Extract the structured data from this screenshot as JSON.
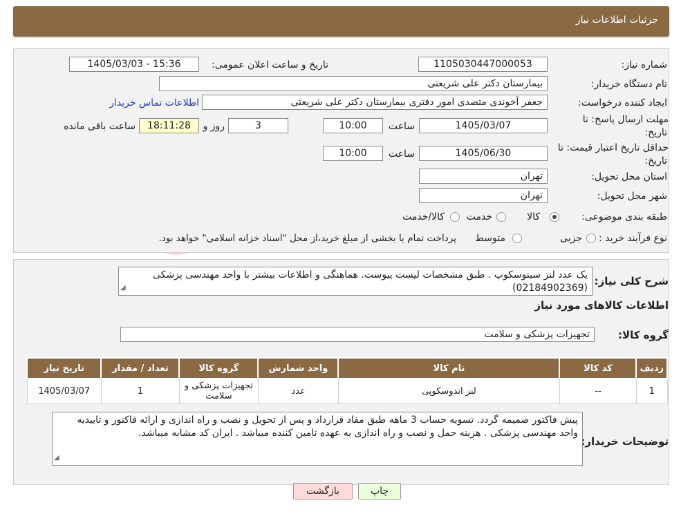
{
  "header": {
    "title": "جزئیات اطلاعات نیاز"
  },
  "form": {
    "need_number": {
      "label": "شماره نیاز:",
      "value": "1105030447000053"
    },
    "announce": {
      "label": "تاریخ و ساعت اعلان عمومی:",
      "value": "1405/03/03 - 15:36"
    },
    "buyer_org": {
      "label": "نام دستگاه خریدار:",
      "value": "بیمارستان دکتر علی شریعتی"
    },
    "creator": {
      "label": "ایجاد کننده درخواست:",
      "value": "جعفر آخوندی متصدی امور دفتری بیمارستان دکتر علی شریعتی",
      "contact_link": "اطلاعات تماس خریدار"
    },
    "reply_deadline": {
      "label_line1": "مهلت ارسال پاسخ: تا",
      "label_line2": "تاریخ:",
      "date": "1405/03/07",
      "time_label": "ساعت",
      "time": "10:00",
      "days": "3",
      "days_label": "روز و",
      "remaining_time": "18:11:28",
      "remaining_label": "ساعت باقی مانده"
    },
    "price_validity": {
      "label_line1": "حداقل تاریخ اعتبار قیمت: تا",
      "label_line2": "تاریخ:",
      "date": "1405/06/30",
      "time_label": "ساعت",
      "time": "10:00"
    },
    "province": {
      "label": "استان محل تحویل:",
      "value": "تهران"
    },
    "city": {
      "label": "شهر محل تحویل:",
      "value": "تهران"
    },
    "category": {
      "label": "طبقه بندی موضوعی:",
      "options": [
        "کالا",
        "خدمت",
        "کالا/خدمت"
      ],
      "selected": "کالا"
    },
    "purchase_type": {
      "label": "نوع فرآیند خرید :",
      "options": [
        "جزیی",
        "متوسط"
      ],
      "note": "پرداخت تمام یا بخشی از مبلغ خرید،از محل \"اسناد خزانه اسلامی\" خواهد بود."
    }
  },
  "description": {
    "label": "شرح کلی نیاز:",
    "text": "یک عدد لنز سینوسکوپ . طبق مشخصات لیست پیوست. هماهنگی و اطلاعات بیشتر با واحد مهندسی پزشکی (02184902369)"
  },
  "goods_section": {
    "title": "اطلاعات کالاهای مورد نیاز",
    "group_label": "گروه کالا:",
    "group_value": "تجهیزات پزشکی و سلامت"
  },
  "table": {
    "headers": [
      "ردیف",
      "کد کالا",
      "نام کالا",
      "واحد شمارش",
      "گروه کالا",
      "تعداد / مقدار",
      "تاریخ نیاز"
    ],
    "rows": [
      [
        "1",
        "--",
        "لنز اندوسکوپی",
        "عدد",
        "تجهیزات پزشکی و سلامت",
        "1",
        "1405/03/07"
      ]
    ]
  },
  "buyer_notes": {
    "label": "توضیحات خریدار:",
    "text": "پیش فاکتور ضمیمه گردد. تسویه حساب 3 ماهه طبق مفاد قرارداد و پس از تحویل و نصب و راه اندازی و ارائه فاکتور و تاییدیه واحد مهندسی پزشکی . هزینه حمل و نصب و راه اندازی به عهده تامین کننده میباشد . ایران کد مشابه میباشد."
  },
  "buttons": {
    "print": "چاپ",
    "back": "بازگشت"
  },
  "colors": {
    "header_bg": "#8b6a43",
    "print_bg": "#eaffd9",
    "back_bg": "#ffdcdc",
    "timer_bg": "#ffffcc",
    "link": "#1a3fb8"
  }
}
